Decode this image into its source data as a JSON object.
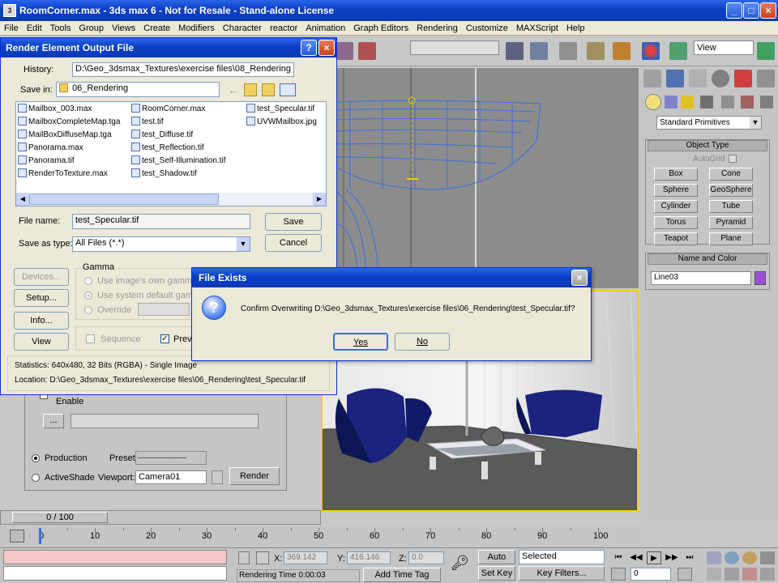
{
  "app": {
    "title": "RoomCorner.max - 3ds max 6 - Not for Resale - Stand-alone License",
    "menu": [
      "File",
      "Edit",
      "Tools",
      "Group",
      "Views",
      "Create",
      "Modifiers",
      "Character",
      "reactor",
      "Animation",
      "Graph Editors",
      "Rendering",
      "Customize",
      "MAXScript",
      "Help"
    ],
    "view_dropdown": "View"
  },
  "command_panel": {
    "dropdown": "Standard Primitives",
    "object_type_header": "Object Type",
    "autogrid": "AutoGrid",
    "buttons": [
      "Box",
      "Cone",
      "Sphere",
      "GeoSphere",
      "Cylinder",
      "Tube",
      "Torus",
      "Pyramid",
      "Teapot",
      "Plane"
    ],
    "name_color_header": "Name and Color",
    "name_value": "Line03",
    "swatch_color": "#9b4fd6"
  },
  "render_dialog": {
    "title": "Render Element Output File",
    "history_label": "History:",
    "history_value": "D:\\Geo_3dsmax_Textures\\exercise files\\08_Rendering",
    "savein_label": "Save in:",
    "savein_value": "06_Rendering",
    "files_col1": [
      "Mailbox_003.max",
      "MailboxCompleteMap.tga",
      "MailBoxDiffuseMap.tga",
      "Panorama.max",
      "Panorama.tif",
      "RenderToTexture.max"
    ],
    "files_col2": [
      "RoomCorner.max",
      "test.tif",
      "test_Diffuse.tif",
      "test_Reflection.tif",
      "test_Self-Illumination.tif",
      "test_Shadow.tif"
    ],
    "files_col3": [
      "test_Specular.tif",
      "UVWMailbox.jpg"
    ],
    "filename_label": "File name:",
    "filename_value": "test_Specular.tif",
    "saveas_label": "Save as type:",
    "saveas_value": "All Files (*.*)",
    "save_btn": "Save",
    "cancel_btn": "Cancel",
    "devices_btn": "Devices...",
    "setup_btn": "Setup...",
    "info_btn": "Info...",
    "view_btn": "View",
    "gamma_label": "Gamma",
    "gamma_opt1": "Use image's own gamma",
    "gamma_opt2": "Use system default gamma",
    "gamma_opt3": "Override",
    "sequence_label": "Sequence",
    "preview_label": "Previ",
    "statistics": "Statistics:  640x480, 32 Bits (RGBA) - Single Image",
    "location": "Location:  D:\\Geo_3dsmax_Textures\\exercise files\\06_Rendering\\test_Specular.tif"
  },
  "file_exists": {
    "title": "File Exists",
    "message": "Confirm Overwriting D:\\Geo_3dsmax_Textures\\exercise files\\06_Rendering\\test_Specular.tif?",
    "yes_btn": "Yes",
    "no_btn": "No"
  },
  "render_panel": {
    "enable_label": "Enable",
    "production": "Production",
    "activeshade": "ActiveShade",
    "preset_label": "Preset:",
    "preset_value": "--------------------",
    "viewport_label": "Viewport:",
    "viewport_value": "Camera01",
    "render_btn": "Render"
  },
  "timeline": {
    "slider_label": "0 / 100",
    "ticks": [
      "0",
      "10",
      "20",
      "30",
      "40",
      "50",
      "60",
      "70",
      "80",
      "90",
      "100"
    ]
  },
  "status": {
    "x_label": "X:",
    "x_value": "369.142",
    "y_label": "Y:",
    "y_value": "416.146",
    "z_label": "Z:",
    "z_value": "0.0",
    "rendering_time": "Rendering Time  0:00:03",
    "add_time_tag": "Add Time Tag",
    "auto_key": "Auto Key",
    "set_key": "Set Key",
    "selected": "Selected",
    "key_filters": "Key Filters...",
    "frame": "0"
  }
}
